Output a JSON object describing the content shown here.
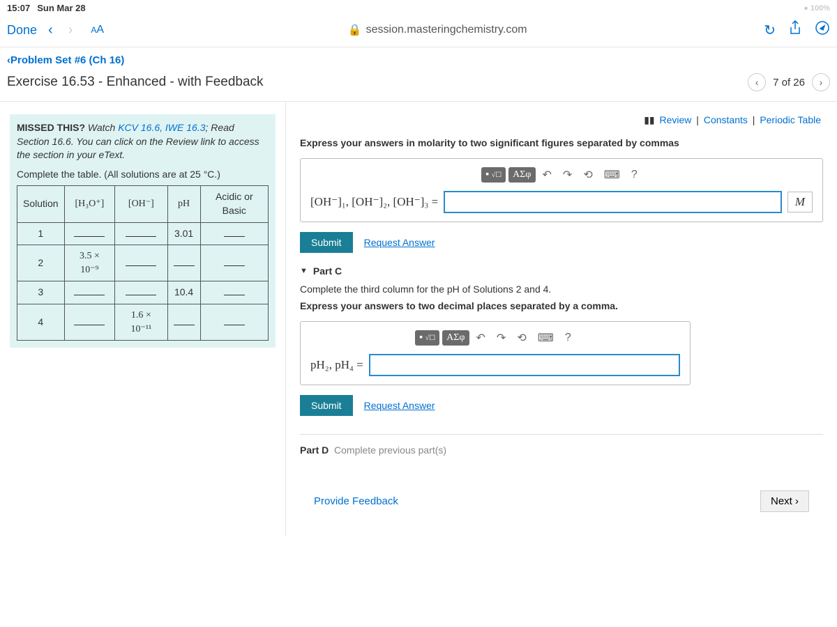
{
  "status": {
    "time": "15:07",
    "date": "Sun Mar 28",
    "wifi": "100%"
  },
  "browser": {
    "done": "Done",
    "aa": "AA",
    "url": "session.masteringchemistry.com"
  },
  "nav": {
    "back": "Problem Set #6 (Ch 16)",
    "title": "Exercise 16.53 - Enhanced - with Feedback",
    "pager": "7 of 26"
  },
  "hint": {
    "lead": "MISSED THIS?",
    "watch": " Watch ",
    "kcv": "KCV 16.6, IWE 16.3",
    "rest": "; Read Section 16.6. You can click on the Review link to access the section in your eText."
  },
  "instr": "Complete the table. (All solutions are at 25 °C.)",
  "headers": {
    "sol": "Solution",
    "h3o": "[H₃O⁺]",
    "oh": "[OH⁻]",
    "ph": "pH",
    "acid": "Acidic or Basic"
  },
  "rows": [
    {
      "n": "1",
      "h3o": "___",
      "oh": "___",
      "ph": "3.01",
      "ab": "___"
    },
    {
      "n": "2",
      "h3o": "3.5 × 10⁻⁹",
      "oh": "___",
      "ph": "___",
      "ab": "___"
    },
    {
      "n": "3",
      "h3o": "___",
      "oh": "___",
      "ph": "10.4",
      "ab": "___"
    },
    {
      "n": "4",
      "h3o": "___",
      "oh": "1.6 × 10⁻¹¹",
      "ph": "___",
      "ab": "___"
    }
  ],
  "review": {
    "r": "Review",
    "c": "Constants",
    "p": "Periodic Table"
  },
  "partB": {
    "prompt": "Express your answers in molarity to two significant figures separated by commas",
    "label": "[OH⁻]₁, [OH⁻]₂, [OH⁻]₃ =",
    "unit": "M",
    "submit": "Submit",
    "req": "Request Answer"
  },
  "partC": {
    "title": "Part C",
    "line1": "Complete the third column for the pH of Solutions 2 and 4.",
    "line2": "Express your answers to two decimal places separated by a comma.",
    "label": "pH₂, pH₄ =",
    "submit": "Submit",
    "req": "Request Answer"
  },
  "partD": {
    "title": "Part D",
    "note": "Complete previous part(s)"
  },
  "toolbar": {
    "sigma": "ΑΣφ",
    "help": "?"
  },
  "footer": {
    "fb": "Provide Feedback",
    "next": "Next"
  }
}
